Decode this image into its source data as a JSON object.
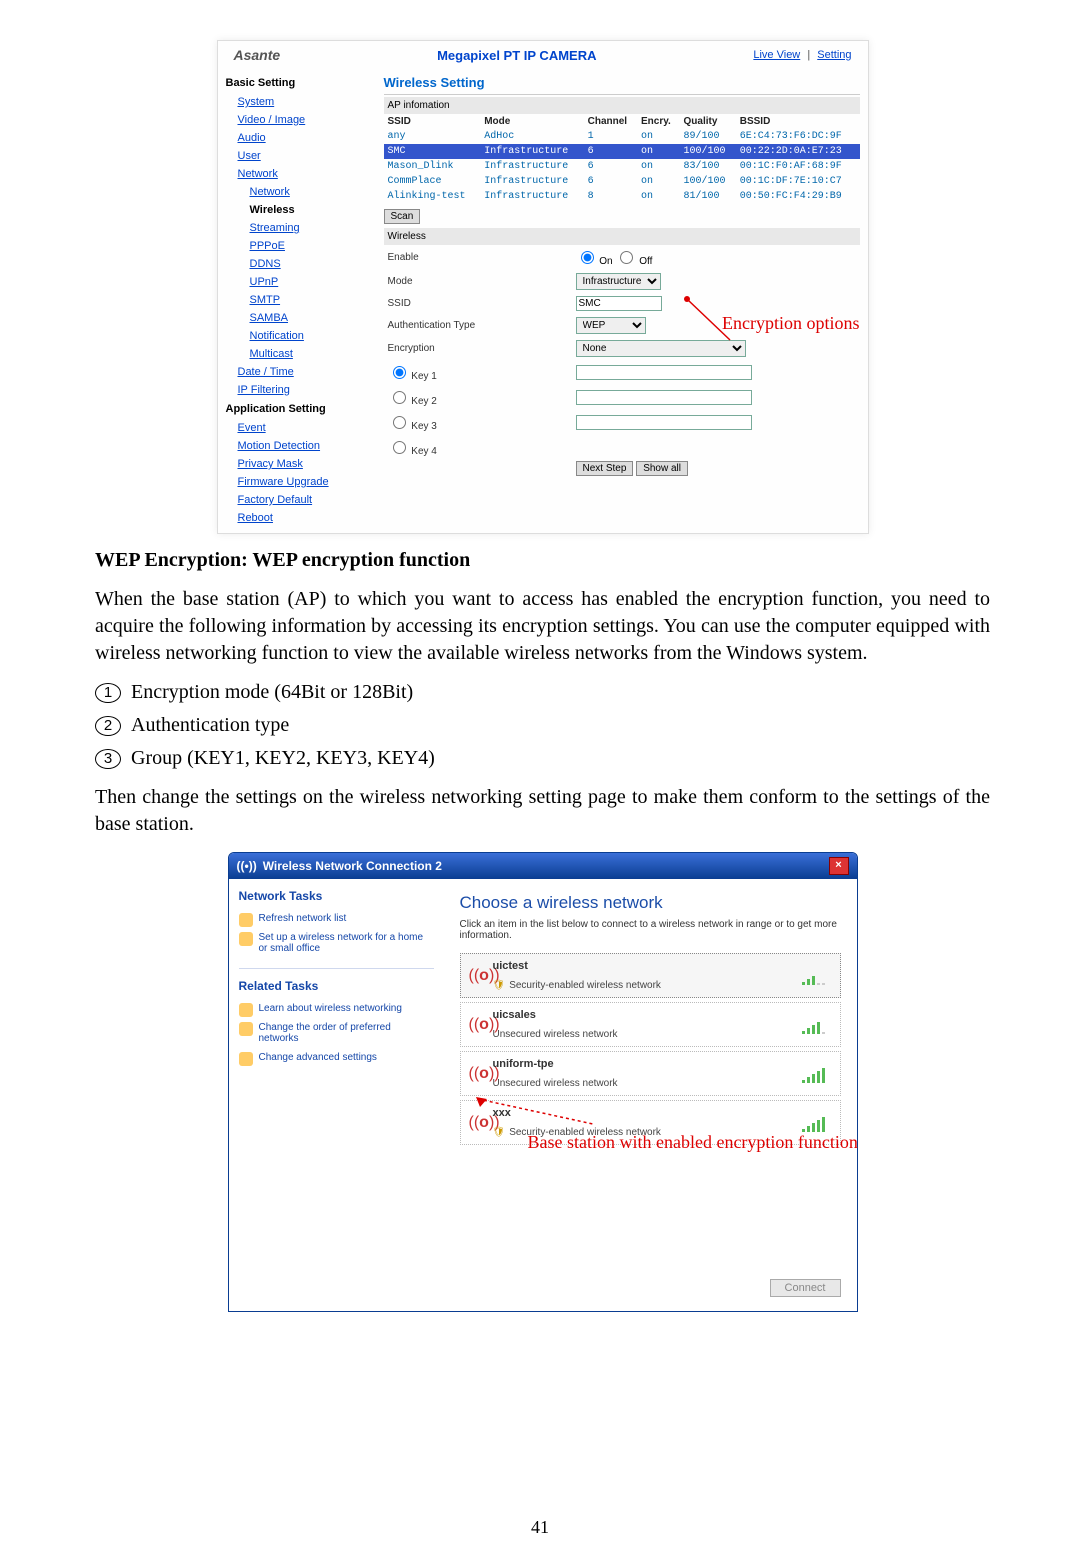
{
  "domain": "Document",
  "page_number": "41",
  "figure1": {
    "brand": "Asante",
    "title": "Megapixel PT IP CAMERA",
    "nav_live": "Live View",
    "nav_sep": "|",
    "nav_setting": "Setting",
    "side": {
      "basic": "Basic Setting",
      "items_basic": [
        "System",
        "Video / Image",
        "Audio",
        "User",
        "Network"
      ],
      "network_sub": [
        "Network",
        "Wireless",
        "Streaming",
        "PPPoE",
        "DDNS",
        "UPnP",
        "SMTP",
        "SAMBA",
        "Notification",
        "Multicast"
      ],
      "datetime": "Date / Time",
      "ipfilter": "IP Filtering",
      "app": "Application Setting",
      "items_app": [
        "Event",
        "Motion Detection",
        "Privacy Mask",
        "Firmware Upgrade",
        "Factory Default",
        "Reboot"
      ]
    },
    "section": "Wireless Setting",
    "apinfo": "AP infomation",
    "cols": {
      "ssid": "SSID",
      "mode": "Mode",
      "channel": "Channel",
      "encry": "Encry.",
      "quality": "Quality",
      "bssid": "BSSID"
    },
    "rows": [
      {
        "ssid": "any",
        "mode": "AdHoc",
        "ch": "1",
        "en": "on",
        "q": "89/100",
        "b": "6E:C4:73:F6:DC:9F",
        "hl": false
      },
      {
        "ssid": "SMC",
        "mode": "Infrastructure",
        "ch": "6",
        "en": "on",
        "q": "100/100",
        "b": "00:22:2D:0A:E7:23",
        "hl": true
      },
      {
        "ssid": "Mason_Dlink",
        "mode": "Infrastructure",
        "ch": "6",
        "en": "on",
        "q": "83/100",
        "b": "00:1C:F0:AF:68:9F",
        "hl": false
      },
      {
        "ssid": "CommPlace",
        "mode": "Infrastructure",
        "ch": "6",
        "en": "on",
        "q": "100/100",
        "b": "00:1C:DF:7E:10:C7",
        "hl": false
      },
      {
        "ssid": "Alinking-test",
        "mode": "Infrastructure",
        "ch": "8",
        "en": "on",
        "q": "81/100",
        "b": "00:50:FC:F4:29:B9",
        "hl": false
      }
    ],
    "scan": "Scan",
    "wireless": "Wireless",
    "form": {
      "enable": "Enable",
      "on": "On",
      "off": "Off",
      "mode": "Mode",
      "mode_val": "Infrastructure",
      "ssid": "SSID",
      "ssid_val": "SMC",
      "auth": "Authentication Type",
      "auth_val": "WEP",
      "encr": "Encryption",
      "encr_val": "None",
      "k1": "Key 1",
      "k2": "Key 2",
      "k3": "Key 3",
      "k4": "Key 4",
      "next": "Next Step",
      "show": "Show all"
    },
    "callout": "Encryption options"
  },
  "heading": "WEP Encryption: WEP encryption function",
  "p1": "When the base station (AP) to which you want to access has enabled the encryption function, you need to acquire the following information by accessing its encryption settings. You can use the computer equipped with wireless networking function to view the available wireless networks from the Windows system.",
  "li1": "Encryption mode (64Bit or 128Bit)",
  "li2": "Authentication type",
  "li3": "Group (KEY1, KEY2, KEY3, KEY4)",
  "p2": "Then change the settings on the wireless networking setting page to make them conform to the settings of the base station.",
  "figure2": {
    "title": "Wireless Network Connection 2",
    "left": {
      "h1": "Network Tasks",
      "l1": "Refresh network list",
      "l2": "Set up a wireless network for a home or small office",
      "h2": "Related Tasks",
      "l3": "Learn about wireless networking",
      "l4": "Change the order of preferred networks",
      "l5": "Change advanced settings"
    },
    "right": {
      "h": "Choose a wireless network",
      "hint": "Click an item in the list below to connect to a wireless network in range or to get more information.",
      "nets": [
        {
          "name": "uictest",
          "sec": "Security-enabled wireless network",
          "secure": true,
          "bars": 3,
          "sel": true
        },
        {
          "name": "uicsales",
          "sec": "Unsecured wireless network",
          "secure": false,
          "bars": 4,
          "sel": false
        },
        {
          "name": "uniform-tpe",
          "sec": "Unsecured wireless network",
          "secure": false,
          "bars": 5,
          "sel": false
        },
        {
          "name": "xxx",
          "sec": "Security-enabled wireless network",
          "secure": true,
          "bars": 5,
          "sel": false
        }
      ],
      "connect": "Connect"
    },
    "callout": "Base station with enabled encryption function"
  }
}
